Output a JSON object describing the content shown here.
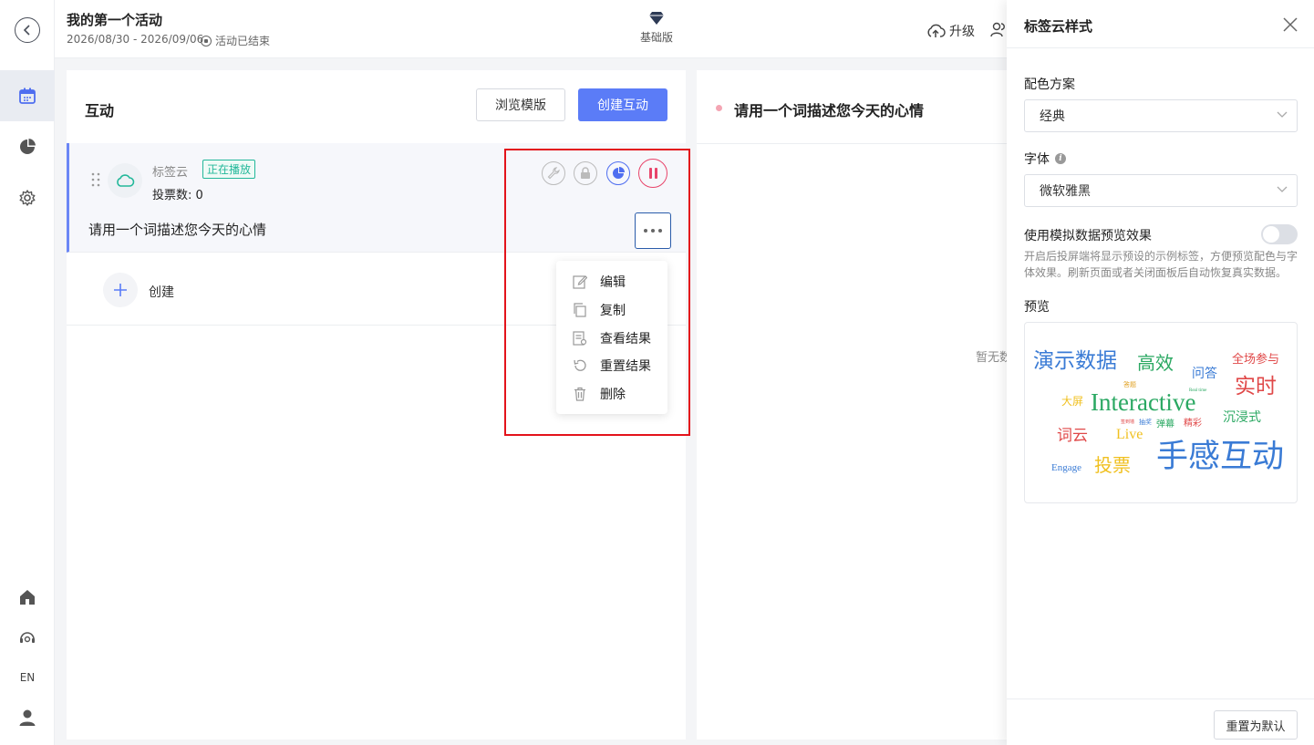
{
  "header": {
    "title": "我的第一个活动",
    "dates": "2026/08/30 - 2026/09/06",
    "status": "活动已结束",
    "plan": "基础版",
    "upgrade": "升级"
  },
  "rail": {
    "lang": "EN"
  },
  "left": {
    "title": "互动",
    "browse_label": "浏览模版",
    "create_label": "创建互动",
    "item": {
      "type": "标签云",
      "badge": "正在播放",
      "votes": "投票数: 0",
      "question": "请用一个词描述您今天的心情"
    },
    "create_row": "创建",
    "menu": [
      "编辑",
      "复制",
      "查看结果",
      "重置结果",
      "删除"
    ]
  },
  "right": {
    "title": "请用一个词描述您今天的心情",
    "empty": "暂无数"
  },
  "panel": {
    "title": "标签云样式",
    "color_label": "配色方案",
    "color_value": "经典",
    "font_label": "字体",
    "font_value": "微软雅黑",
    "mock_label": "使用模拟数据预览效果",
    "mock_enabled": false,
    "help": "开启后投屏端将显示预设的示例标签，方便预览配色与字体效果。刷新页面或者关闭面板后自动恢复真实数据。",
    "preview_label": "预览",
    "reset_label": "重置为默认",
    "words": [
      "演示数据",
      "高效",
      "全场参与",
      "问答",
      "实时",
      "答题",
      "大屏",
      "Interactive",
      "Real time",
      "沉浸式",
      "词云",
      "Live",
      "弹幕",
      "精彩",
      "抽奖",
      "签到墙",
      "手感互动",
      "Engage",
      "投票"
    ]
  },
  "colors": {
    "accent": "#5b7cf7",
    "playing": "#23b89a",
    "pause": "#e8446a",
    "highlight": "#e3131b"
  }
}
